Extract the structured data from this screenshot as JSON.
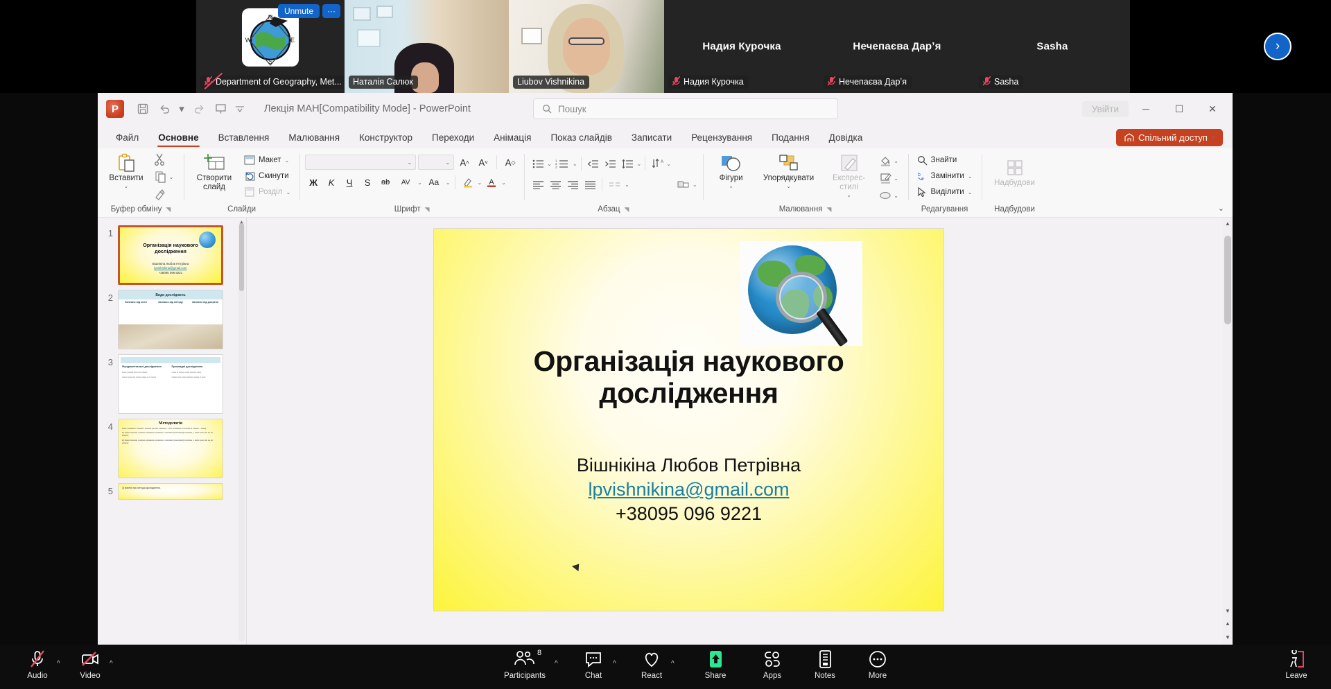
{
  "meeting": {
    "participants": [
      {
        "name": "Department of Geography, Met...",
        "muted": true,
        "kind": "logo",
        "speaking": false,
        "controls": {
          "unmute_label": "Unmute",
          "more_label": "···"
        }
      },
      {
        "name": "Наталія Салюк",
        "muted": false,
        "kind": "video",
        "speaking": false
      },
      {
        "name": "Liubov Vishnikina",
        "muted": false,
        "kind": "video",
        "speaking": true
      },
      {
        "name": "Надия Курочка",
        "muted": true,
        "kind": "avatar",
        "speaking": false
      },
      {
        "name": "Нечепаєва Дарʼя",
        "muted": true,
        "kind": "avatar",
        "speaking": false
      },
      {
        "name": "Sasha",
        "muted": true,
        "kind": "avatar",
        "speaking": false
      }
    ],
    "next_arrow": "›",
    "toolbar": [
      {
        "id": "audio",
        "label": "Audio",
        "caret": "^",
        "state": "muted"
      },
      {
        "id": "video",
        "label": "Video",
        "caret": "^",
        "state": "off"
      },
      {
        "id": "participants",
        "label": "Participants",
        "caret": "^",
        "count": "8"
      },
      {
        "id": "chat",
        "label": "Chat",
        "caret": "^"
      },
      {
        "id": "react",
        "label": "React",
        "caret": "^"
      },
      {
        "id": "share",
        "label": "Share"
      },
      {
        "id": "apps",
        "label": "Apps"
      },
      {
        "id": "notes",
        "label": "Notes"
      },
      {
        "id": "more",
        "label": "More"
      },
      {
        "id": "leave",
        "label": "Leave"
      }
    ]
  },
  "powerpoint": {
    "titlebar": {
      "app_initial": "P",
      "document_title": "Лекція МАН[Compatibility Mode]  -  PowerPoint",
      "quick_access": [
        "save-icon",
        "undo-icon",
        "redo-icon",
        "present-icon",
        "customize-qat-icon"
      ],
      "sign_in_label": "Увійти",
      "window_buttons": [
        "─",
        "☐",
        "✕"
      ]
    },
    "search": {
      "placeholder": "Пошук"
    },
    "tabs": [
      {
        "label": "Файл",
        "active": false
      },
      {
        "label": "Основне",
        "active": true
      },
      {
        "label": "Вставлення",
        "active": false
      },
      {
        "label": "Малювання",
        "active": false
      },
      {
        "label": "Конструктор",
        "active": false
      },
      {
        "label": "Переходи",
        "active": false
      },
      {
        "label": "Анімація",
        "active": false
      },
      {
        "label": "Показ слайдів",
        "active": false
      },
      {
        "label": "Записати",
        "active": false
      },
      {
        "label": "Рецензування",
        "active": false
      },
      {
        "label": "Подання",
        "active": false
      },
      {
        "label": "Довідка",
        "active": false
      }
    ],
    "share_button": "Спільний доступ",
    "ribbon": {
      "clipboard": {
        "group_label": "Буфер обміну",
        "paste_label": "Вставити",
        "cut_icon": "scissors-icon",
        "copy_icon": "copy-icon",
        "format_painter_icon": "format-painter-icon"
      },
      "slides": {
        "group_label": "Слайди",
        "new_slide_label": "Створити слайд",
        "layout_label": "Макет",
        "reset_label": "Скинути",
        "section_label": "Розділ"
      },
      "font": {
        "group_label": "Шрифт",
        "font_name_value": "",
        "font_size_value": "",
        "grow_label": "A",
        "shrink_label": "A",
        "clear_format_label": "A",
        "bold_label": "Ж",
        "italic_label": "K",
        "underline_label": "Ч",
        "shadow_label": "S",
        "strike_label": "ab",
        "spacing_label": "AV",
        "case_label": "Aa",
        "highlight_label": "A",
        "color_label": "A"
      },
      "paragraph": {
        "group_label": "Абзац"
      },
      "drawing": {
        "group_label": "Малювання",
        "shapes_label": "Фігури",
        "arrange_label": "Упорядкувати",
        "quick_styles_label": "Експрес-стилі"
      },
      "editing": {
        "group_label": "Редагування",
        "find_label": "Знайти",
        "replace_label": "Замінити",
        "select_label": "Виділити"
      },
      "addins": {
        "group_label": "Надбудови",
        "button_label": "Надбудови"
      }
    },
    "thumbnails": [
      {
        "num": "1",
        "type": "title",
        "selected": true,
        "title": "Організація наукового дослідження",
        "author": "Вішнікіна Любов Петрівна",
        "email": "lpvishnikina@gmail.com",
        "phone": "+38095 096 9221"
      },
      {
        "num": "2",
        "type": "table",
        "selected": false,
        "heading": "Види досліджень",
        "cols": [
          "Залежно від мети",
          "Залежно від методу",
          "Залежно від джерела"
        ]
      },
      {
        "num": "3",
        "type": "twocol",
        "selected": false,
        "left_head": "Фундаментальні дослідження",
        "right_head": "Прикладні дослідження"
      },
      {
        "num": "4",
        "type": "method",
        "selected": false,
        "heading": "Методологія"
      },
      {
        "num": "5",
        "type": "partial",
        "selected": false,
        "heading": "3) вчення про методи дослідження."
      }
    ],
    "slide": {
      "title": "Організація наукового дослідження",
      "author": "Вішнікіна Любов Петрівна",
      "email": "lpvishnikina@gmail.com",
      "phone": "+38095 096 9221"
    }
  },
  "colors": {
    "ppt_accent": "#c43e1c",
    "share_button": "#c6411f",
    "teams_blue": "#1264c8",
    "speaking_green": "#42d392",
    "mute_red": "#e8485f",
    "slide_yellow": "#fdf43c",
    "link_teal": "#1a7fa0"
  }
}
